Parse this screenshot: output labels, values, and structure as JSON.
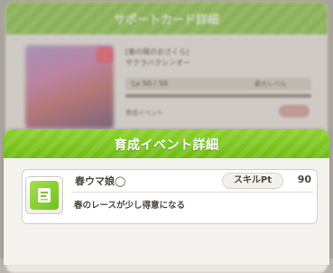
{
  "background": {
    "header_title": "サポートカード詳細",
    "card_name_line1": "[春の陽のおさくら]",
    "card_name_line2": "サクラバクシンオー",
    "level_text": "Lv 50 / 50",
    "level_right_text": "最大レベル",
    "small_label": "育成イベント"
  },
  "dialog": {
    "title": "育成イベント詳細",
    "event": {
      "icon": "event-card-icon",
      "name": "春ウマ娘◯",
      "badge_label": "スキルPt",
      "badge_value": "90",
      "effect": "春のレースが少し得意になる"
    }
  },
  "colors": {
    "header_green": "#7cc41e",
    "text_brown": "#4f473c",
    "dialog_bg": "#f4f2ef"
  }
}
